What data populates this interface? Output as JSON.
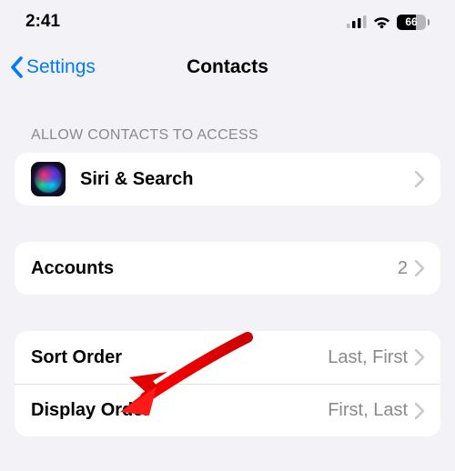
{
  "status": {
    "time": "2:41",
    "battery_pct": "66"
  },
  "nav": {
    "back_label": "Settings",
    "title": "Contacts"
  },
  "section_allow_header": "ALLOW CONTACTS TO ACCESS",
  "rows": {
    "siri": {
      "label": "Siri & Search"
    },
    "accounts": {
      "label": "Accounts",
      "value": "2"
    },
    "sort_order": {
      "label": "Sort Order",
      "value": "Last, First"
    },
    "display_order": {
      "label": "Display Order",
      "value": "First, Last"
    }
  }
}
